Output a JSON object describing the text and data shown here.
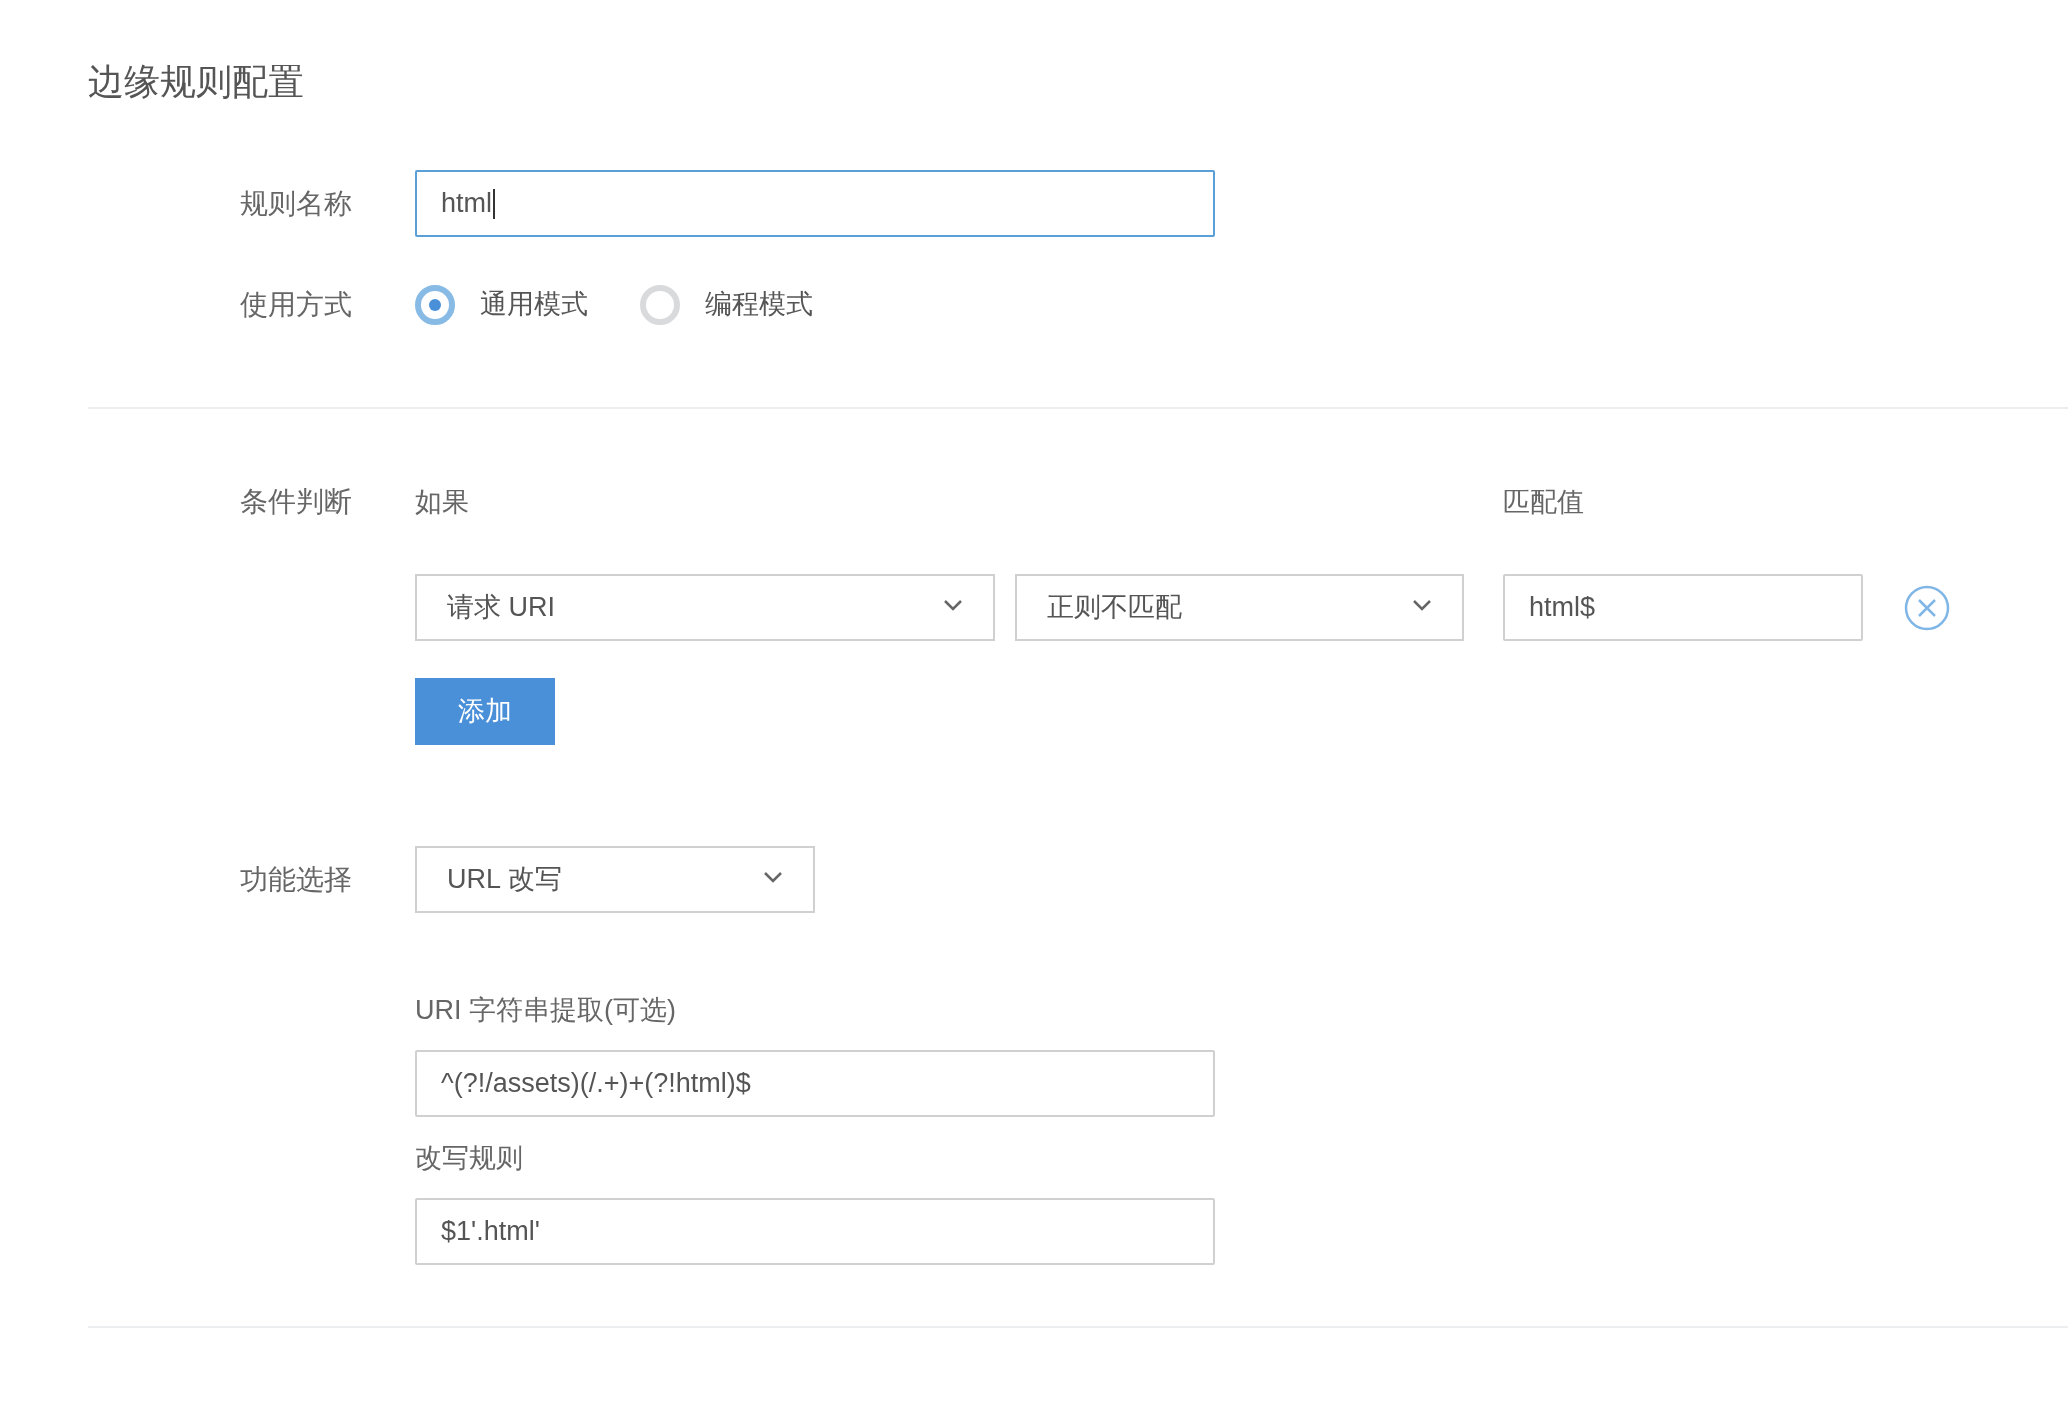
{
  "title": "边缘规则配置",
  "rule_name": {
    "label": "规则名称",
    "value": "html",
    "focused": true
  },
  "usage_mode": {
    "label": "使用方式",
    "options": [
      {
        "label": "通用模式",
        "selected": true
      },
      {
        "label": "编程模式",
        "selected": false
      }
    ]
  },
  "conditions": {
    "label": "条件判断",
    "if_label": "如果",
    "match_value_label": "匹配值",
    "rows": [
      {
        "field": "请求 URI",
        "operator": "正则不匹配",
        "value": "html$"
      }
    ],
    "add_button": "添加"
  },
  "feature": {
    "label": "功能选择",
    "value": "URL 改写"
  },
  "rewrite_fields": [
    {
      "label": "URI 字符串提取(可选)",
      "value": "^(?!/assets)(/.+)+(?!html)$"
    },
    {
      "label": "改写规则",
      "value": "$1'.html'"
    }
  ]
}
